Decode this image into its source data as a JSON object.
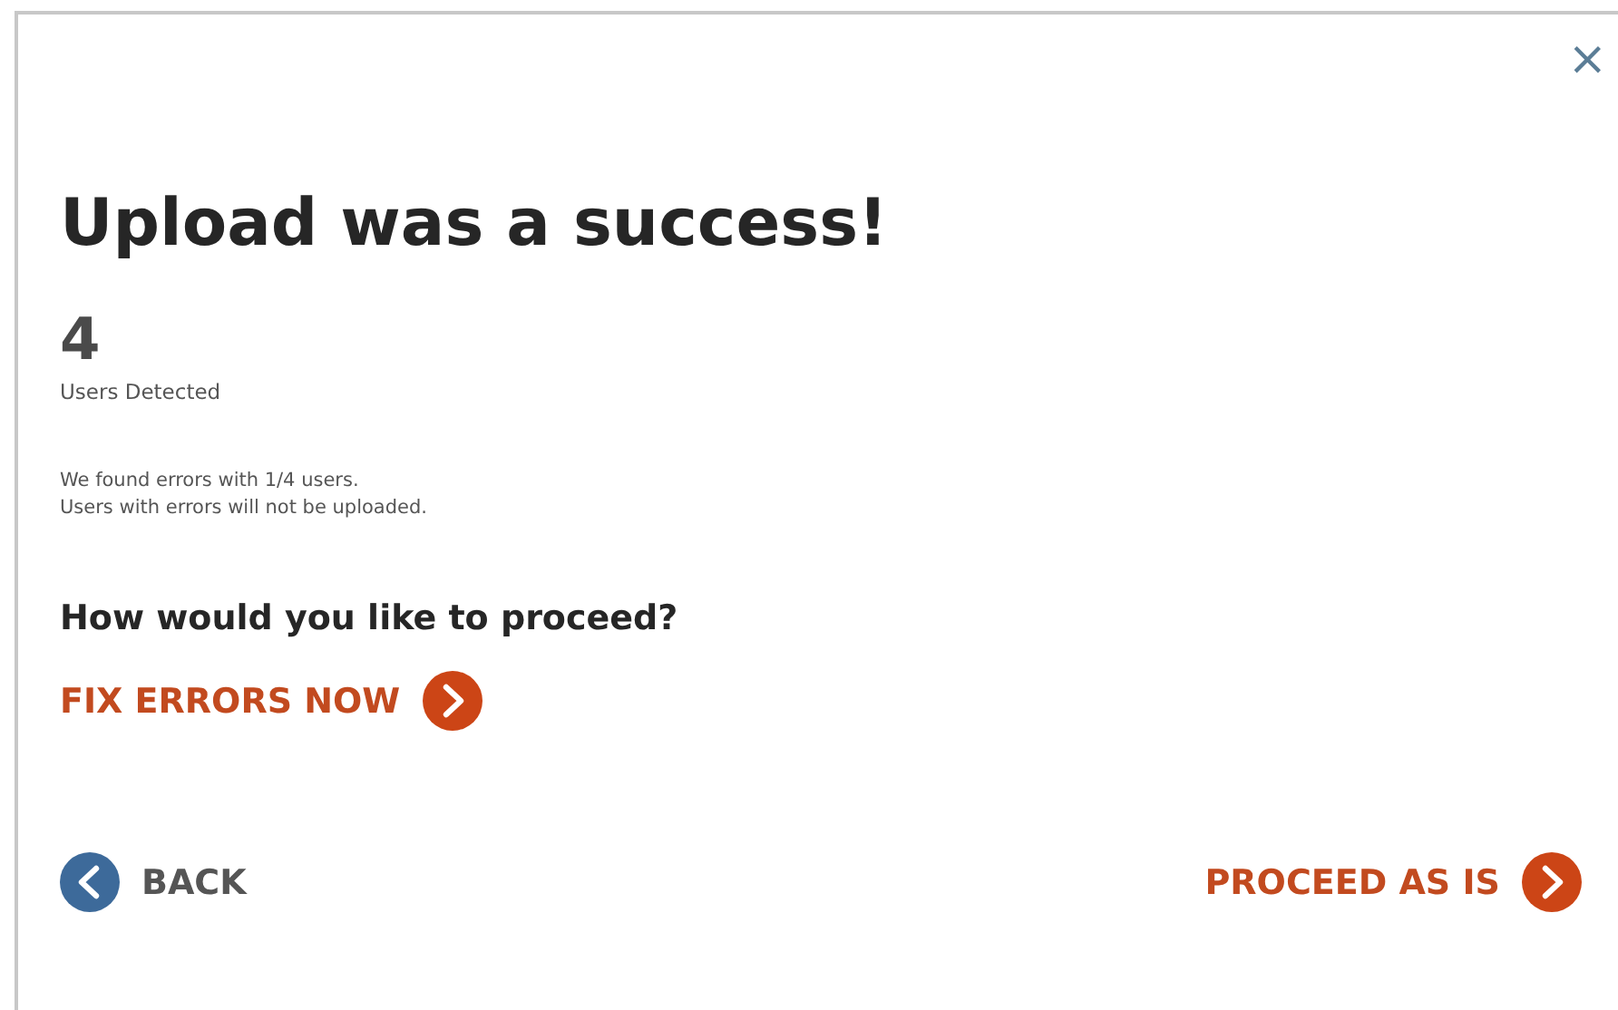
{
  "dialog": {
    "close": "×",
    "title": "Upload was a success!",
    "count": "4",
    "count_label": "Users Detected",
    "messages": [
      "We found errors with 1/4 users.",
      "Users with errors will not be uploaded."
    ],
    "question": "How would you like to proceed?",
    "fix_button": {
      "label": "FIX ERRORS NOW"
    },
    "back_button": {
      "label": "BACK"
    },
    "proceed_button": {
      "label": "PROCEED AS IS"
    }
  }
}
